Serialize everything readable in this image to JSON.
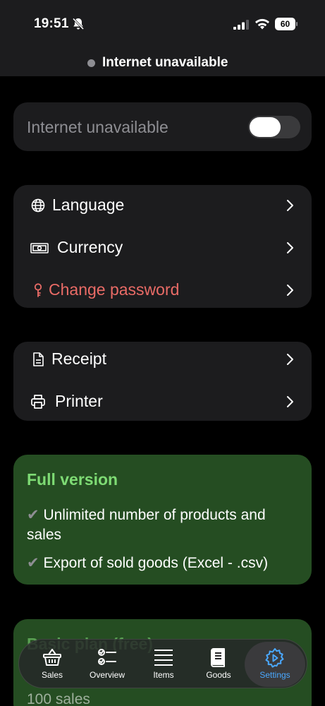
{
  "status_bar": {
    "time": "19:51",
    "battery": "60",
    "icons": [
      "bell-off-icon",
      "signal-icon",
      "wifi-icon",
      "battery-icon"
    ]
  },
  "network_banner": {
    "text": "Internet unavailable"
  },
  "offline_toggle": {
    "label": "Internet unavailable",
    "on": false
  },
  "settings_group_1": [
    {
      "label": "Language",
      "icon": "globe-icon"
    },
    {
      "label": "Currency",
      "icon": "banknote-icon"
    },
    {
      "label": "Change password",
      "icon": "key-icon",
      "color": "#e96b66"
    }
  ],
  "settings_group_2": [
    {
      "label": "Receipt",
      "icon": "document-icon"
    },
    {
      "label": "Printer",
      "icon": "printer-icon"
    }
  ],
  "full_version": {
    "title": "Full version",
    "check": "✔",
    "items": [
      "Unlimited number of products and sales",
      "Export of sold goods (Excel - .csv)"
    ]
  },
  "basic_version": {
    "title": "Basic plan (free)",
    "items": [
      "100 sales"
    ]
  },
  "tab_bar": {
    "tabs": [
      {
        "label": "Sales",
        "icon": "basket-icon"
      },
      {
        "label": "Overview",
        "icon": "checklist-icon"
      },
      {
        "label": "Items",
        "icon": "list-icon"
      },
      {
        "label": "Goods",
        "icon": "book-icon"
      },
      {
        "label": "Settings",
        "icon": "gear-icon",
        "active": true
      }
    ],
    "active_color": "#4aa8ff"
  },
  "colors": {
    "background": "#000000",
    "card": "#1c1c1e",
    "promo": "#254d22",
    "promo_title": "#7edb74",
    "danger": "#e96b66"
  }
}
